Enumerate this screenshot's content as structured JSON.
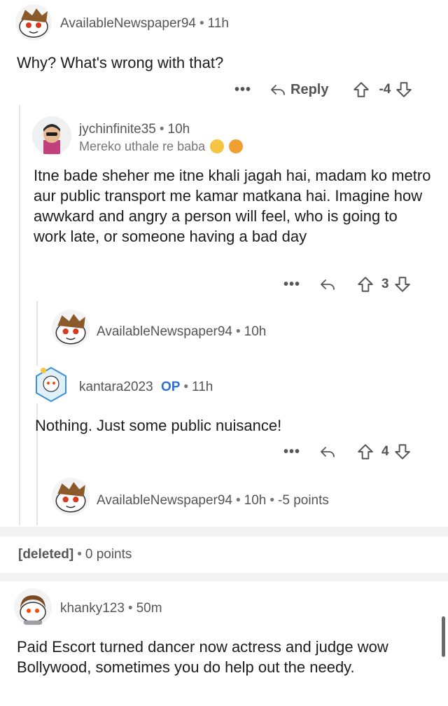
{
  "comments": {
    "c1": {
      "username": "AvailableNewspaper94",
      "time": "11h",
      "body": "Why? What's wrong with that?",
      "more_label": "•••",
      "reply_label": "Reply",
      "score": "-4"
    },
    "c2": {
      "username": "jychinfinite35",
      "time": "10h",
      "flair": "Mereko uthale re baba",
      "body": "Itne bade sheher me itne khali jagah hai, madam ko metro aur public transport me kamar matkana hai. Imagine how awwkard and angry a person will feel, who is going to work late, or someone having a bad day",
      "more_label": "•••",
      "score": "3"
    },
    "c3": {
      "username": "AvailableNewspaper94",
      "time": "10h"
    },
    "c4": {
      "username": "kantara2023",
      "op_label": "OP",
      "time": "11h",
      "body": "Nothing. Just some public nuisance!",
      "more_label": "•••",
      "score": "4"
    },
    "c5": {
      "username": "AvailableNewspaper94",
      "time": "10h",
      "points": "-5 points"
    },
    "deleted": {
      "label": "[deleted]",
      "points": "0 points"
    },
    "c6": {
      "username": "khanky123",
      "time": "50m",
      "body": "Paid Escort turned dancer now actress and judge wow Bollywood, sometimes you do help out the needy."
    }
  },
  "separator": "•",
  "icons": {
    "more": "ellipsis-icon",
    "reply": "reply-arrow-icon",
    "upvote": "upvote-arrow-icon",
    "downvote": "downvote-arrow-icon"
  },
  "colors": {
    "op": "#2f6fd6",
    "text": "#1c1c1c",
    "meta": "#777777",
    "thread_line": "#e6e6e6"
  }
}
